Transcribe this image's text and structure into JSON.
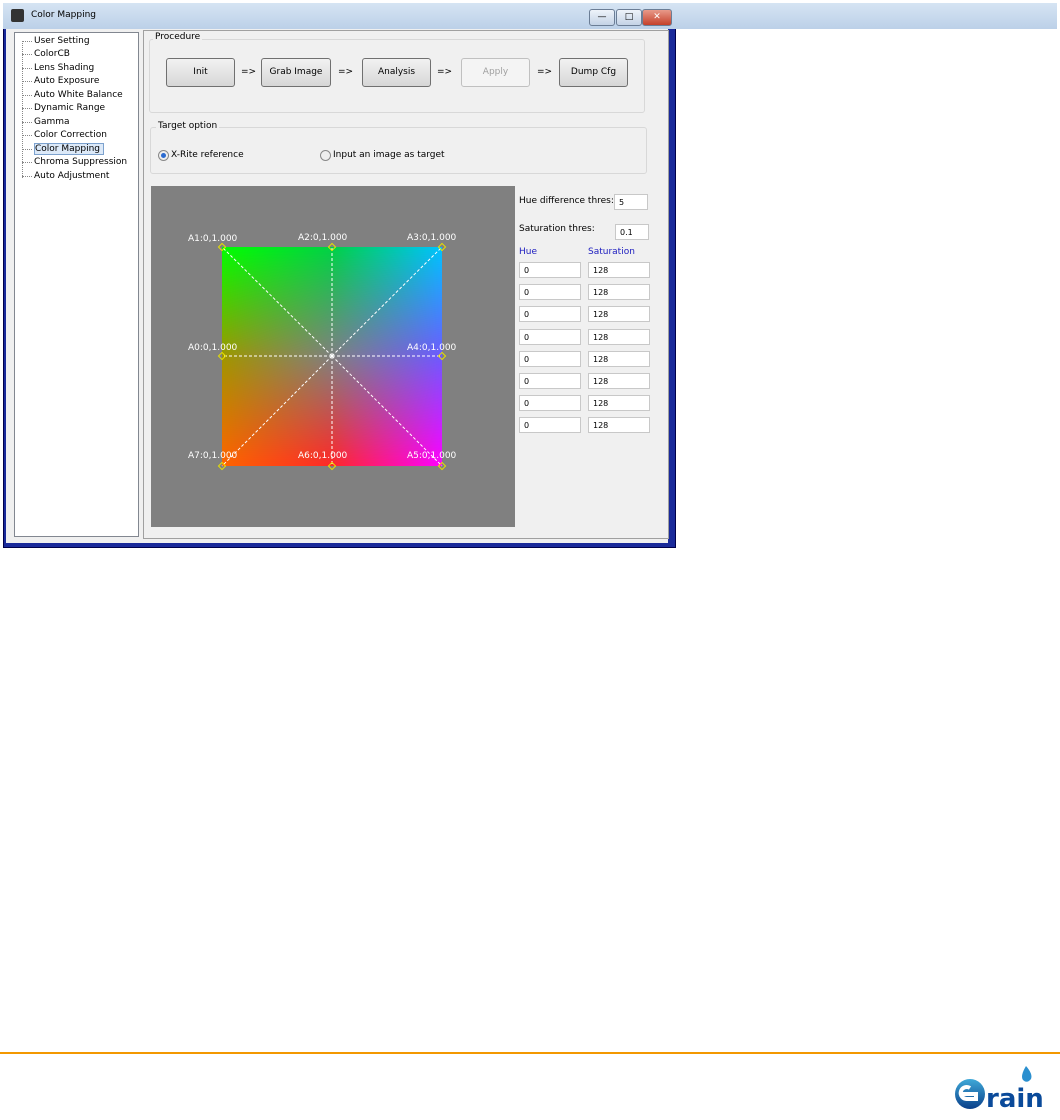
{
  "window": {
    "title": "Color Mapping",
    "minimize": "—",
    "maximize": "□",
    "close": "✕"
  },
  "tree": [
    "User Setting",
    "ColorCB",
    "Lens Shading",
    "Auto Exposure",
    "Auto White Balance",
    "Dynamic Range",
    "Gamma",
    "Color Correction",
    "Color Mapping",
    "Chroma Suppression",
    "Auto Adjustment"
  ],
  "tree_selected": "Color Mapping",
  "procedure": {
    "label": "Procedure",
    "buttons": [
      "Init",
      "Grab Image",
      "Analysis",
      "Apply",
      "Dump Cfg"
    ],
    "arrow": "=>"
  },
  "target": {
    "label": "Target option",
    "options": [
      "X-Rite reference",
      "Input an image as target"
    ],
    "selected": "X-Rite reference"
  },
  "points": [
    "A0:0,1.000",
    "A1:0,1.000",
    "A2:0,1.000",
    "A3:0,1.000",
    "A4:0,1.000",
    "A5:0,1.000",
    "A6:0,1.000",
    "A7:0,1.000"
  ],
  "params": {
    "hue_diff_label": "Hue difference thres:",
    "hue_diff": "5",
    "sat_label": "Saturation thres:",
    "sat": "0.1",
    "hue_header": "Hue",
    "sat_header": "Saturation"
  },
  "rows": [
    {
      "hue": "0",
      "sat": "128"
    },
    {
      "hue": "0",
      "sat": "128"
    },
    {
      "hue": "0",
      "sat": "128"
    },
    {
      "hue": "0",
      "sat": "128"
    },
    {
      "hue": "0",
      "sat": "128"
    },
    {
      "hue": "0",
      "sat": "128"
    },
    {
      "hue": "0",
      "sat": "128"
    },
    {
      "hue": "0",
      "sat": "128"
    }
  ],
  "footer": {
    "logo_text": "Grain",
    "accent": "#f39800"
  }
}
